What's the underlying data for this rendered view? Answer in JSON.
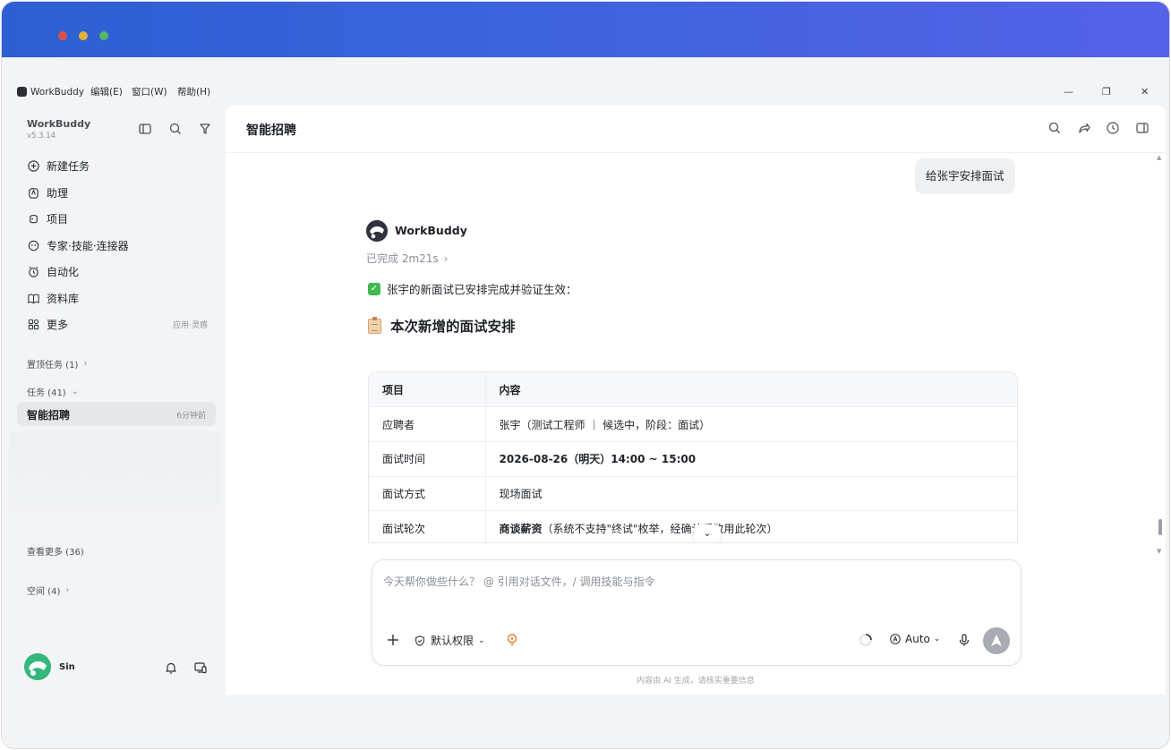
{
  "menubar": {
    "app_name": "WorkBuddy",
    "items": [
      "编辑(E)",
      "窗口(W)",
      "帮助(H)"
    ],
    "window_controls": [
      "—",
      "❐",
      "✕"
    ]
  },
  "sidebar": {
    "brand": "WorkBuddy",
    "version": "v5.3.14",
    "nav": [
      {
        "label": "新建任务",
        "icon": "plus-circle-icon"
      },
      {
        "label": "助理",
        "icon": "assistant-icon"
      },
      {
        "label": "项目",
        "icon": "project-icon"
      },
      {
        "label": "专家·技能·连接器",
        "icon": "expert-icon"
      },
      {
        "label": "自动化",
        "icon": "alarm-clock-icon"
      },
      {
        "label": "资料库",
        "icon": "book-icon"
      },
      {
        "label": "更多",
        "icon": "apps-icon",
        "extra": "应用·灵感"
      }
    ],
    "pinned": "置顶任务 (1)",
    "tasks": "任务 (41)",
    "active_task": {
      "name": "智能招聘",
      "time": "6分钟前"
    },
    "see_more": "查看更多 (36)",
    "spaces": "空间 (4)",
    "user": "Sin"
  },
  "main": {
    "title": "智能招聘",
    "user_message": "给张宇安排面试",
    "bot_name": "WorkBuddy",
    "status": "已完成 2m21s",
    "check_text": "张宇的新面试已安排完成并验证生效：",
    "section_title": "本次新增的面试安排",
    "table": {
      "headers": [
        "项目",
        "内容"
      ],
      "rows": [
        {
          "key": "应聘者",
          "value": "张宇（测试工程师 ｜ 候选中，阶段：面试）",
          "bold": ""
        },
        {
          "key": "面试时间",
          "value": "",
          "bold": "2026-08-26（明天）14:00 ~ 15:00"
        },
        {
          "key": "面试方式",
          "value": "现场面试",
          "bold": ""
        },
        {
          "key": "面试轮次",
          "value": "（系统不支持\"终试\"枚举，经确认后改用此轮次）",
          "bold": "商谈薪资"
        }
      ]
    },
    "scroll_chip": "⌄"
  },
  "composer": {
    "placeholder": "今天帮你做些什么？ @ 引用对话文件，/ 调用技能与指令",
    "permission": "默认权限",
    "model": "Auto",
    "footer": "内容由 AI 生成，请核实重要信息"
  },
  "colors": {
    "title_gradient_start": "#2d5fd3",
    "title_gradient_end": "#5662e8",
    "check_green": "#3fb950",
    "send_button": "#a7abb2"
  }
}
